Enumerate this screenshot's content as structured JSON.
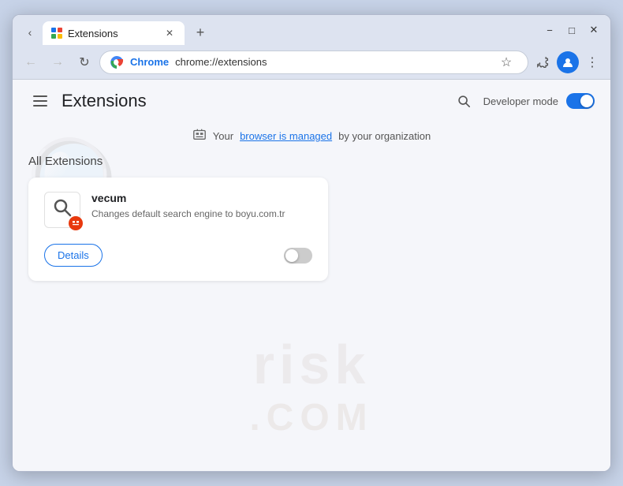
{
  "window": {
    "tab_title": "Extensions",
    "tab_url": "chrome://extensions",
    "new_tab_label": "+",
    "minimize_label": "−",
    "maximize_label": "□",
    "close_label": "✕"
  },
  "nav": {
    "back_label": "←",
    "forward_label": "→",
    "reload_label": "↺",
    "chrome_label": "Chrome",
    "url": "chrome://extensions",
    "bookmark_label": "☆",
    "extensions_label": "⊞",
    "profile_label": "👤",
    "menu_label": "⋮"
  },
  "page": {
    "title": "Extensions",
    "search_label": "🔍",
    "dev_mode_label": "Developer mode",
    "managed_notice": "Your",
    "managed_link": "browser is managed",
    "managed_by": "by your organization",
    "section_title": "All Extensions"
  },
  "extension": {
    "name": "vecum",
    "description": "Changes default search engine to boyu.com.tr",
    "details_label": "Details"
  }
}
